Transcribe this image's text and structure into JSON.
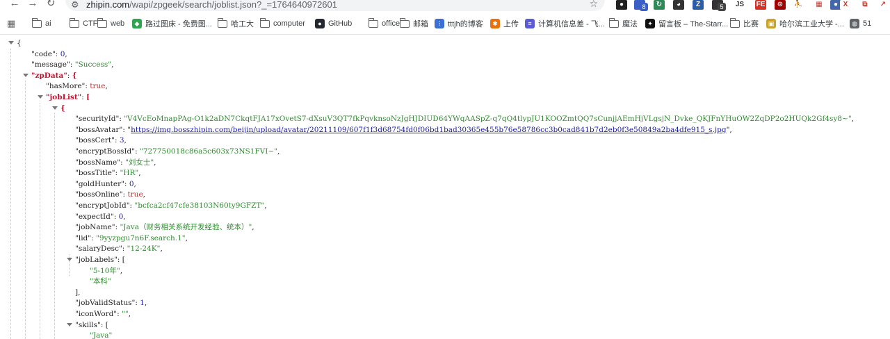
{
  "browser": {
    "url_host": "zhipin.com",
    "url_rest": "/wapi/zpgeek/search/joblist.json?_=1764640972601",
    "extensions": [
      {
        "name": "extension-dark-circle",
        "color": "#222222",
        "glyph": "●"
      },
      {
        "name": "extension-blue-badge",
        "color": "#3b5fc9",
        "glyph": "",
        "badge": "8",
        "badge_color": "#3b5fc9"
      },
      {
        "name": "extension-green",
        "color": "#2e8b57",
        "glyph": "↻"
      },
      {
        "name": "extension-panda",
        "color": "#333333",
        "glyph": "◕"
      },
      {
        "name": "extension-blue-z",
        "color": "#2a5ea8",
        "glyph": "Z"
      },
      {
        "name": "extension-dark-badge",
        "color": "#333333",
        "glyph": "",
        "badge": "5",
        "badge_color": "#444444"
      },
      {
        "name": "extension-js",
        "color": "#ffffff",
        "glyph": "JS"
      },
      {
        "name": "extension-fe",
        "color": "#d93025",
        "glyph": "FE"
      },
      {
        "name": "extension-red-square",
        "color": "#a00000",
        "glyph": "⊙"
      },
      {
        "name": "extension-runner",
        "color": "#ffffff",
        "glyph": "⛹"
      },
      {
        "name": "extension-grid",
        "color": "#ffffff",
        "glyph": "▦"
      },
      {
        "name": "extension-blue-dot",
        "color": "#4466aa",
        "glyph": "●"
      },
      {
        "name": "extension-red-x",
        "color": "#ffffff",
        "glyph": "X"
      },
      {
        "name": "extension-puzzle",
        "color": "#ffffff",
        "glyph": "⧉"
      },
      {
        "name": "extension-arrow",
        "color": "#ffffff",
        "glyph": "↗"
      }
    ]
  },
  "bookmarks": [
    {
      "label": "ai",
      "icon": "folder-icon"
    },
    {
      "label": "CTF",
      "icon": "folder-icon"
    },
    {
      "label": "web",
      "icon": "folder-icon"
    },
    {
      "label": "路过图床 - 免费图...",
      "icon": "favicon-green",
      "color": "#2ea44f",
      "glyph": "◆"
    },
    {
      "label": "哈工大",
      "icon": "folder-icon"
    },
    {
      "label": "computer",
      "icon": "folder-icon"
    },
    {
      "label": "GitHub",
      "icon": "github-icon",
      "color": "#24292f",
      "glyph": "●"
    },
    {
      "label": "office",
      "icon": "folder-icon"
    },
    {
      "label": "邮箱",
      "icon": "folder-icon"
    },
    {
      "label": "tttjh的博客",
      "icon": "favicon-blue",
      "color": "#3b6fd6",
      "glyph": "⫶"
    },
    {
      "label": "上传",
      "icon": "favicon-multicolor",
      "color": "#e8710a",
      "glyph": "✱"
    },
    {
      "label": "计算机信息差 - 飞...",
      "icon": "favicon-purple",
      "color": "#5b5bd6",
      "glyph": "≡"
    },
    {
      "label": "魔法",
      "icon": "folder-icon"
    },
    {
      "label": "留言板 – The-Starr...",
      "icon": "favicon-dark",
      "color": "#111111",
      "glyph": "✦"
    },
    {
      "label": "比赛",
      "icon": "folder-icon"
    },
    {
      "label": "哈尔滨工业大学 -...",
      "icon": "favicon-yellow",
      "color": "#c9a227",
      "glyph": "▣"
    },
    {
      "label": "51",
      "icon": "globe-icon",
      "color": "#5f6368",
      "glyph": "◍"
    }
  ],
  "json_lines": [
    {
      "ind": 0,
      "arrow": true,
      "parts": [
        {
          "t": "{",
          "c": "p"
        }
      ]
    },
    {
      "ind": 1,
      "parts": [
        {
          "t": "\"code\"",
          "c": "k"
        },
        {
          "t": ": ",
          "c": "p"
        },
        {
          "t": "0",
          "c": "n"
        },
        {
          "t": ",",
          "c": "p"
        }
      ]
    },
    {
      "ind": 1,
      "parts": [
        {
          "t": "\"message\"",
          "c": "k"
        },
        {
          "t": ": ",
          "c": "p"
        },
        {
          "t": "\"Success\"",
          "c": "s"
        },
        {
          "t": ",",
          "c": "p"
        }
      ]
    },
    {
      "ind": 1,
      "arrow": true,
      "red": true,
      "parts": [
        {
          "t": "\"zpData\"",
          "c": "key-red"
        },
        {
          "t": ": ",
          "c": "p"
        },
        {
          "t": "{",
          "c": "bracket-red"
        }
      ]
    },
    {
      "ind": 2,
      "parts": [
        {
          "t": "\"hasMore\"",
          "c": "k"
        },
        {
          "t": ": ",
          "c": "p"
        },
        {
          "t": "true",
          "c": "b"
        },
        {
          "t": ",",
          "c": "p"
        }
      ]
    },
    {
      "ind": 2,
      "arrow": true,
      "red": true,
      "parts": [
        {
          "t": "\"jobList\"",
          "c": "key-red"
        },
        {
          "t": ": ",
          "c": "p"
        },
        {
          "t": "[",
          "c": "bracket-red"
        }
      ]
    },
    {
      "ind": 3,
      "arrow": true,
      "red": true,
      "parts": [
        {
          "t": "{",
          "c": "bracket-red"
        }
      ]
    },
    {
      "ind": 4,
      "parts": [
        {
          "t": "\"securityId\"",
          "c": "k"
        },
        {
          "t": ": ",
          "c": "p"
        },
        {
          "t": "\"V4VcEoMnapPAg-O1k2aDN7CkqtFJA17xOvetS7-dXsuV3QT7fkPqvknsoNzJgHJDIUD64YWqAASpZ-q7qQ4tlypJU1KOOZmtQQ7sCunjjAEmHjVLgsjN_Dvke_QKJFnYHuOW2ZqDP2o2HUQk2Gf4sy8~\"",
          "c": "s"
        },
        {
          "t": ",",
          "c": "p"
        }
      ]
    },
    {
      "ind": 4,
      "parts": [
        {
          "t": "\"bossAvatar\"",
          "c": "k"
        },
        {
          "t": ": ",
          "c": "p"
        },
        {
          "t": "\"",
          "c": "p"
        },
        {
          "t": "https://img.bosszhipin.com/beijin/upload/avatar/20211109/607f1f3d68754fd0f06bd1bad30365e455b76e58786cc3b0cad841b7d2eb0f3e50849a2ba4dfe915_s.jpg",
          "c": "u"
        },
        {
          "t": "\",",
          "c": "p"
        }
      ]
    },
    {
      "ind": 4,
      "parts": [
        {
          "t": "\"bossCert\"",
          "c": "k"
        },
        {
          "t": ": ",
          "c": "p"
        },
        {
          "t": "3",
          "c": "n"
        },
        {
          "t": ",",
          "c": "p"
        }
      ]
    },
    {
      "ind": 4,
      "parts": [
        {
          "t": "\"encryptBossId\"",
          "c": "k"
        },
        {
          "t": ": ",
          "c": "p"
        },
        {
          "t": "\"727750018c86a5c603x73NS1FVI~\"",
          "c": "s"
        },
        {
          "t": ",",
          "c": "p"
        }
      ]
    },
    {
      "ind": 4,
      "parts": [
        {
          "t": "\"bossName\"",
          "c": "k"
        },
        {
          "t": ": ",
          "c": "p"
        },
        {
          "t": "\"刘女士\"",
          "c": "s"
        },
        {
          "t": ",",
          "c": "p"
        }
      ]
    },
    {
      "ind": 4,
      "parts": [
        {
          "t": "\"bossTitle\"",
          "c": "k"
        },
        {
          "t": ": ",
          "c": "p"
        },
        {
          "t": "\"HR\"",
          "c": "s"
        },
        {
          "t": ",",
          "c": "p"
        }
      ]
    },
    {
      "ind": 4,
      "parts": [
        {
          "t": "\"goldHunter\"",
          "c": "k"
        },
        {
          "t": ": ",
          "c": "p"
        },
        {
          "t": "0",
          "c": "n"
        },
        {
          "t": ",",
          "c": "p"
        }
      ]
    },
    {
      "ind": 4,
      "parts": [
        {
          "t": "\"bossOnline\"",
          "c": "k"
        },
        {
          "t": ": ",
          "c": "p"
        },
        {
          "t": "true",
          "c": "b"
        },
        {
          "t": ",",
          "c": "p"
        }
      ]
    },
    {
      "ind": 4,
      "parts": [
        {
          "t": "\"encryptJobId\"",
          "c": "k"
        },
        {
          "t": ": ",
          "c": "p"
        },
        {
          "t": "\"bcfca2cf47cfe38103N60ty9GFZT\"",
          "c": "s"
        },
        {
          "t": ",",
          "c": "p"
        }
      ]
    },
    {
      "ind": 4,
      "parts": [
        {
          "t": "\"expectId\"",
          "c": "k"
        },
        {
          "t": ": ",
          "c": "p"
        },
        {
          "t": "0",
          "c": "n"
        },
        {
          "t": ",",
          "c": "p"
        }
      ]
    },
    {
      "ind": 4,
      "parts": [
        {
          "t": "\"jobName\"",
          "c": "k"
        },
        {
          "t": ": ",
          "c": "p"
        },
        {
          "t": "\"Java（财务相关系统开发经验、统本）\"",
          "c": "s"
        },
        {
          "t": ",",
          "c": "p"
        }
      ]
    },
    {
      "ind": 4,
      "parts": [
        {
          "t": "\"lid\"",
          "c": "k"
        },
        {
          "t": ": ",
          "c": "p"
        },
        {
          "t": "\"9yyzpgu7n6F.search.1\"",
          "c": "s"
        },
        {
          "t": ",",
          "c": "p"
        }
      ]
    },
    {
      "ind": 4,
      "parts": [
        {
          "t": "\"salaryDesc\"",
          "c": "k"
        },
        {
          "t": ": ",
          "c": "p"
        },
        {
          "t": "\"12-24K\"",
          "c": "s"
        },
        {
          "t": ",",
          "c": "p"
        }
      ]
    },
    {
      "ind": 4,
      "arrow": true,
      "parts": [
        {
          "t": "\"jobLabels\"",
          "c": "k"
        },
        {
          "t": ": [",
          "c": "p"
        }
      ]
    },
    {
      "ind": 5,
      "parts": [
        {
          "t": "\"5-10年\"",
          "c": "s"
        },
        {
          "t": ",",
          "c": "p"
        }
      ]
    },
    {
      "ind": 5,
      "parts": [
        {
          "t": "\"本科\"",
          "c": "s"
        }
      ]
    },
    {
      "ind": 4,
      "parts": [
        {
          "t": "],",
          "c": "p"
        }
      ]
    },
    {
      "ind": 4,
      "parts": [
        {
          "t": "\"jobValidStatus\"",
          "c": "k"
        },
        {
          "t": ": ",
          "c": "p"
        },
        {
          "t": "1",
          "c": "n"
        },
        {
          "t": ",",
          "c": "p"
        }
      ]
    },
    {
      "ind": 4,
      "parts": [
        {
          "t": "\"iconWord\"",
          "c": "k"
        },
        {
          "t": ": ",
          "c": "p"
        },
        {
          "t": "\"\"",
          "c": "s"
        },
        {
          "t": ",",
          "c": "p"
        }
      ]
    },
    {
      "ind": 4,
      "arrow": true,
      "parts": [
        {
          "t": "\"skills\"",
          "c": "k"
        },
        {
          "t": ": [",
          "c": "p"
        }
      ]
    },
    {
      "ind": 5,
      "parts": [
        {
          "t": "\"Java\"",
          "c": "s"
        }
      ]
    }
  ]
}
